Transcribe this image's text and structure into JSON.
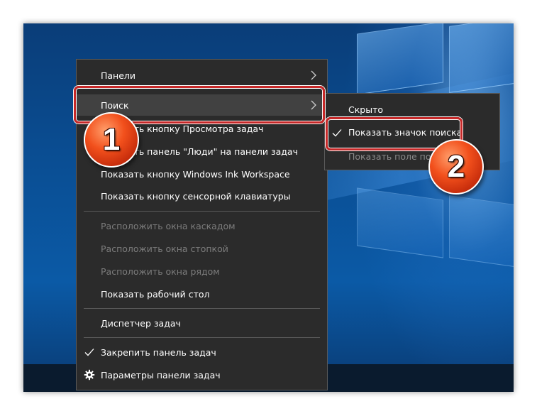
{
  "context_menu": {
    "items": [
      {
        "label": "Панели",
        "has_submenu": true,
        "enabled": true
      },
      {
        "label": "Поиск",
        "has_submenu": true,
        "enabled": true,
        "highlighted": true
      },
      {
        "label": "Показать кнопку Просмотра задач",
        "enabled": true
      },
      {
        "label": "Показать панель \"Люди\" на панели задач",
        "enabled": true
      },
      {
        "label": "Показать кнопку Windows Ink Workspace",
        "enabled": true
      },
      {
        "label": "Показать кнопку сенсорной клавиатуры",
        "enabled": true
      },
      {
        "label": "Расположить окна каскадом",
        "enabled": false
      },
      {
        "label": "Расположить окна стопкой",
        "enabled": false
      },
      {
        "label": "Расположить окна рядом",
        "enabled": false
      },
      {
        "label": "Показать рабочий стол",
        "enabled": true
      },
      {
        "label": "Диспетчер задач",
        "enabled": true
      },
      {
        "label": "Закрепить панель задач",
        "enabled": true,
        "checked": true
      },
      {
        "label": "Параметры панели задач",
        "enabled": true,
        "icon": "gear-icon"
      }
    ]
  },
  "search_submenu": {
    "items": [
      {
        "label": "Скрыто",
        "checked": false
      },
      {
        "label": "Показать значок поиска",
        "checked": true
      },
      {
        "label": "Показать поле поиска",
        "checked": false
      }
    ]
  },
  "annotations": {
    "step1": "1",
    "step2": "2"
  },
  "colors": {
    "menu_bg": "#2b2b2b",
    "menu_highlight": "#414141",
    "disabled_text": "#7c7c7c",
    "annotation_red": "#c62828",
    "badge_orange": "#f2501c",
    "desktop_blue": "#0a4d92"
  }
}
